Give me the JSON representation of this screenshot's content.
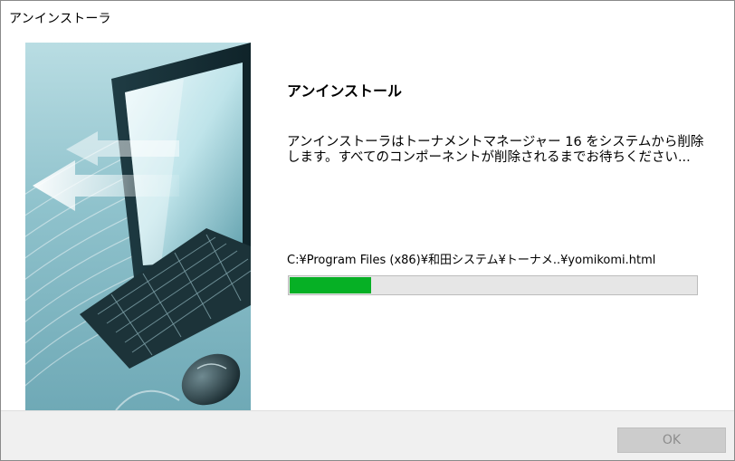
{
  "window": {
    "title": "アンインストーラ"
  },
  "main": {
    "heading": "アンインストール",
    "description": "アンインストーラはトーナメントマネージャー 16 をシステムから削除します。すべてのコンポーネントが削除されるまでお待ちください...",
    "current_file": "C:¥Program Files (x86)¥和田システム¥トーナメ..¥yomikomi.html",
    "progress_fraction": 0.2
  },
  "footer": {
    "ok_label": "OK",
    "ok_enabled": false
  },
  "colors": {
    "progress": "#06b025",
    "footer_bg": "#f0f0f0",
    "button_disabled_bg": "#cccccc",
    "button_disabled_text": "#8d8d8d"
  },
  "icons": {
    "banner": "computer-uninstall-illustration"
  }
}
